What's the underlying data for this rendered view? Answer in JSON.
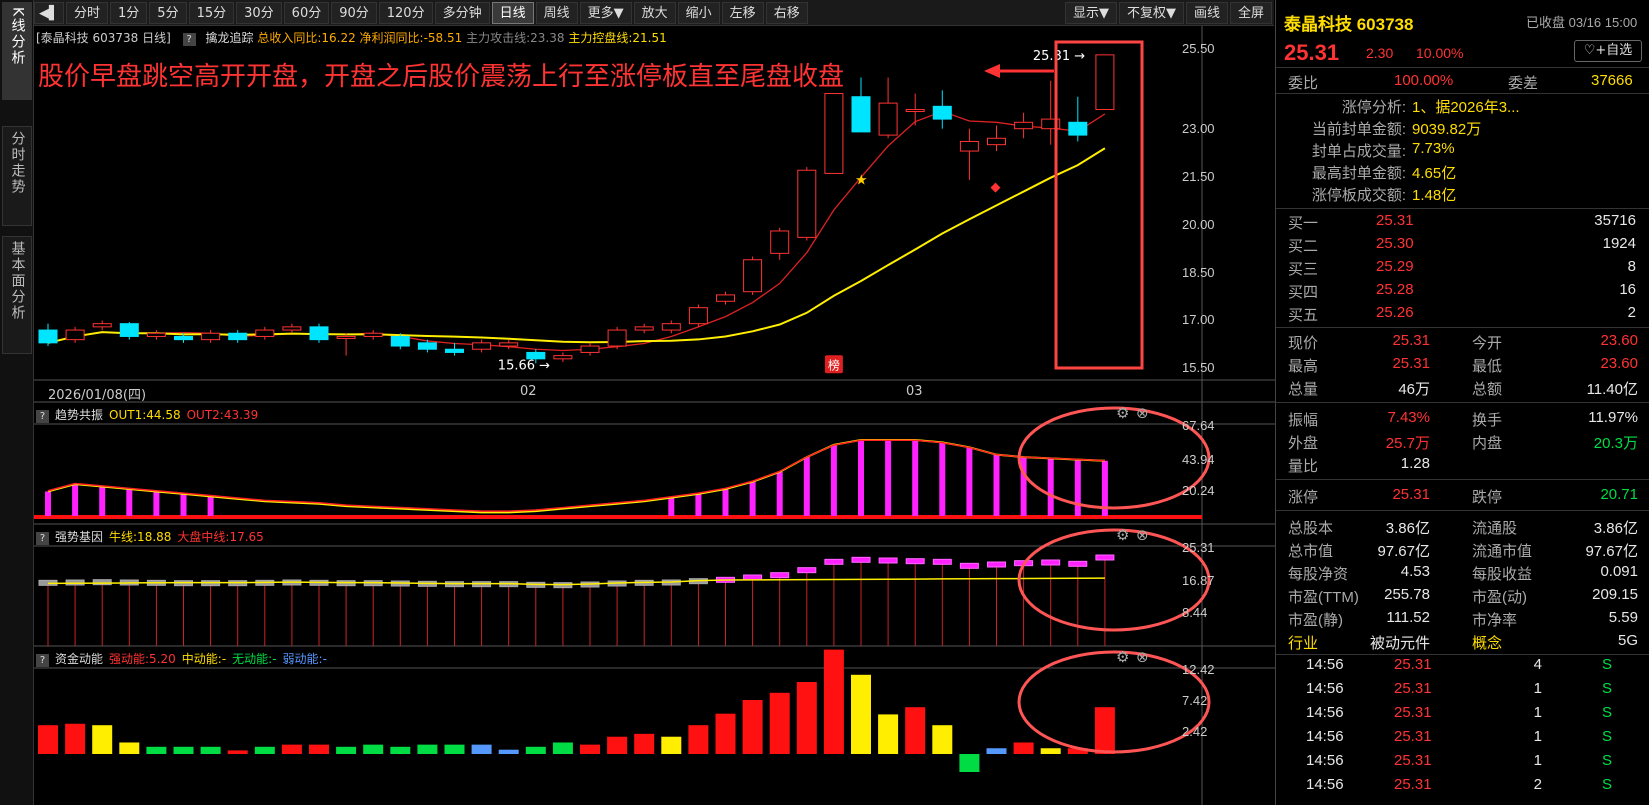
{
  "toolbar": {
    "collapse_icon": "collapse-left-icon",
    "periods": [
      "分时",
      "1分",
      "5分",
      "15分",
      "30分",
      "60分",
      "90分",
      "120分",
      "多分钟",
      "日线",
      "周线",
      "更多▼",
      "放大",
      "缩小",
      "左移",
      "右移"
    ],
    "active_period": "日线",
    "right_buttons": [
      "显示▼",
      "不复权▼",
      "画线",
      "全屏"
    ]
  },
  "left_tabs": [
    {
      "label": "K线分析",
      "active": true
    },
    {
      "label": "分时走势",
      "active": false
    },
    {
      "label": "基本面分析",
      "active": false
    }
  ],
  "main_info": {
    "stock": "[泰晶科技 603738 日线]",
    "indicator": "擒龙追踪",
    "revenue": "总收入同比:16.22",
    "profit": "净利润同比:-58.51",
    "attack": "主力攻击线:23.38",
    "control": "主力控盘线:21.51"
  },
  "annotation": {
    "text": "股价早盘跳空高开开盘，开盘之后股价震荡上行至涨停板直至尾盘收盘",
    "color": "#ff3333"
  },
  "main_y_labels": [
    "25.50",
    "23.00",
    "21.50",
    "20.00",
    "18.50",
    "17.00",
    "15.50"
  ],
  "main_markers": {
    "high": "25.31",
    "low": "15.66",
    "bang": "榜"
  },
  "x_labels": {
    "date": "2026/01/08(四)",
    "m2": "02",
    "m3": "03"
  },
  "panel1": {
    "name": "趋势共振",
    "out1": "OUT1:44.58",
    "out2": "OUT2:43.39",
    "y_labels": [
      "67.64",
      "43.94",
      "20.24"
    ]
  },
  "panel2": {
    "name": "强势基因",
    "bull": "牛线:18.88",
    "market": "大盘中线:17.65",
    "y_labels": [
      "25.31",
      "16.87",
      "8.44"
    ]
  },
  "panel3": {
    "name": "资金动能",
    "strong": "强动能:5.20",
    "mid": "中动能:-",
    "none": "无动能:-",
    "weak": "弱动能:-",
    "y_labels": [
      "12.42",
      "7.42",
      "2.42"
    ]
  },
  "chart_data": {
    "type": "candlestick",
    "candles": [
      [
        16.7,
        16.3,
        16.9,
        16.2
      ],
      [
        16.4,
        16.7,
        16.8,
        16.3
      ],
      [
        16.8,
        16.9,
        17.0,
        16.7
      ],
      [
        16.9,
        16.5,
        16.95,
        16.4
      ],
      [
        16.5,
        16.6,
        16.7,
        16.4
      ],
      [
        16.5,
        16.4,
        16.6,
        16.3
      ],
      [
        16.4,
        16.6,
        16.7,
        16.3
      ],
      [
        16.6,
        16.4,
        16.7,
        16.3
      ],
      [
        16.5,
        16.7,
        16.8,
        16.4
      ],
      [
        16.7,
        16.8,
        16.9,
        16.6
      ],
      [
        16.8,
        16.4,
        16.9,
        16.3
      ],
      [
        16.5,
        16.5,
        16.6,
        15.9
      ],
      [
        16.5,
        16.6,
        16.7,
        16.4
      ],
      [
        16.5,
        16.2,
        16.6,
        16.1
      ],
      [
        16.3,
        16.1,
        16.4,
        16.0
      ],
      [
        16.1,
        16.0,
        16.3,
        15.9
      ],
      [
        16.1,
        16.3,
        16.4,
        16.0
      ],
      [
        16.2,
        16.3,
        16.4,
        16.1
      ],
      [
        16.0,
        15.8,
        16.1,
        15.66
      ],
      [
        15.8,
        15.9,
        16.0,
        15.7
      ],
      [
        16.0,
        16.2,
        16.3,
        15.9
      ],
      [
        16.2,
        16.7,
        16.8,
        16.1
      ],
      [
        16.7,
        16.8,
        16.9,
        16.6
      ],
      [
        16.7,
        16.9,
        17.0,
        16.6
      ],
      [
        16.9,
        17.4,
        17.5,
        16.8
      ],
      [
        17.6,
        17.8,
        17.9,
        17.5
      ],
      [
        17.9,
        18.9,
        19.0,
        17.8
      ],
      [
        19.1,
        19.8,
        19.9,
        18.9
      ],
      [
        19.6,
        21.7,
        21.8,
        19.5
      ],
      [
        21.6,
        24.1,
        24.1,
        21.6
      ],
      [
        24.0,
        22.9,
        24.6,
        22.9
      ],
      [
        22.8,
        23.8,
        24.6,
        22.7
      ],
      [
        23.6,
        23.6,
        24.1,
        23.1
      ],
      [
        23.7,
        23.3,
        24.2,
        23.0
      ],
      [
        22.3,
        22.6,
        23.0,
        21.4
      ],
      [
        22.5,
        22.7,
        23.1,
        22.3
      ],
      [
        23.0,
        23.2,
        23.5,
        22.7
      ],
      [
        23.0,
        23.3,
        24.5,
        22.5
      ],
      [
        23.2,
        22.8,
        24.0,
        22.6
      ],
      [
        23.6,
        25.31,
        25.31,
        23.6
      ]
    ],
    "ylim": [
      15.2,
      25.9
    ]
  }
}
